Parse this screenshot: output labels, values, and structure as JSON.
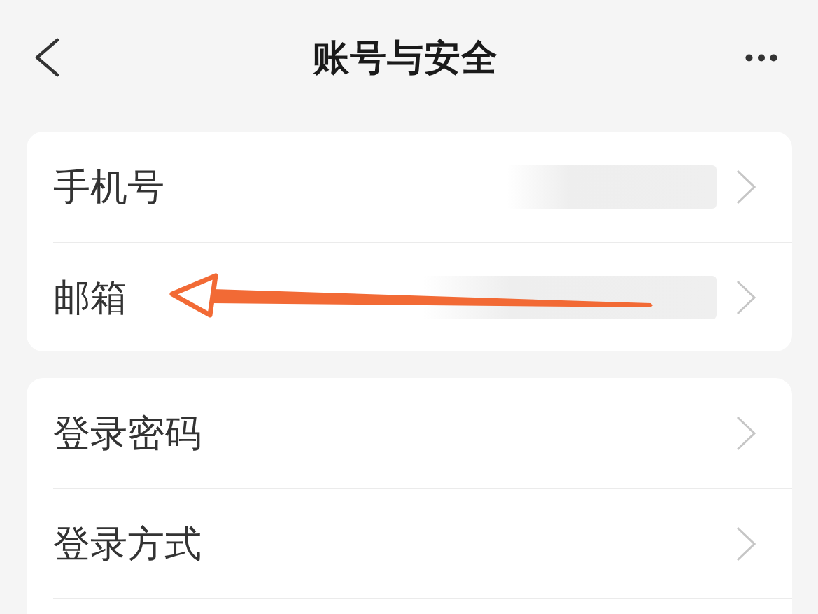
{
  "header": {
    "title": "账号与安全"
  },
  "sections": [
    {
      "truncated": false,
      "rows": [
        {
          "label": "手机号",
          "masked": true
        },
        {
          "label": "邮箱",
          "masked": true
        }
      ]
    },
    {
      "truncated": true,
      "rows": [
        {
          "label": "登录密码",
          "masked": false
        },
        {
          "label": "登录方式",
          "masked": false
        }
      ]
    }
  ]
}
